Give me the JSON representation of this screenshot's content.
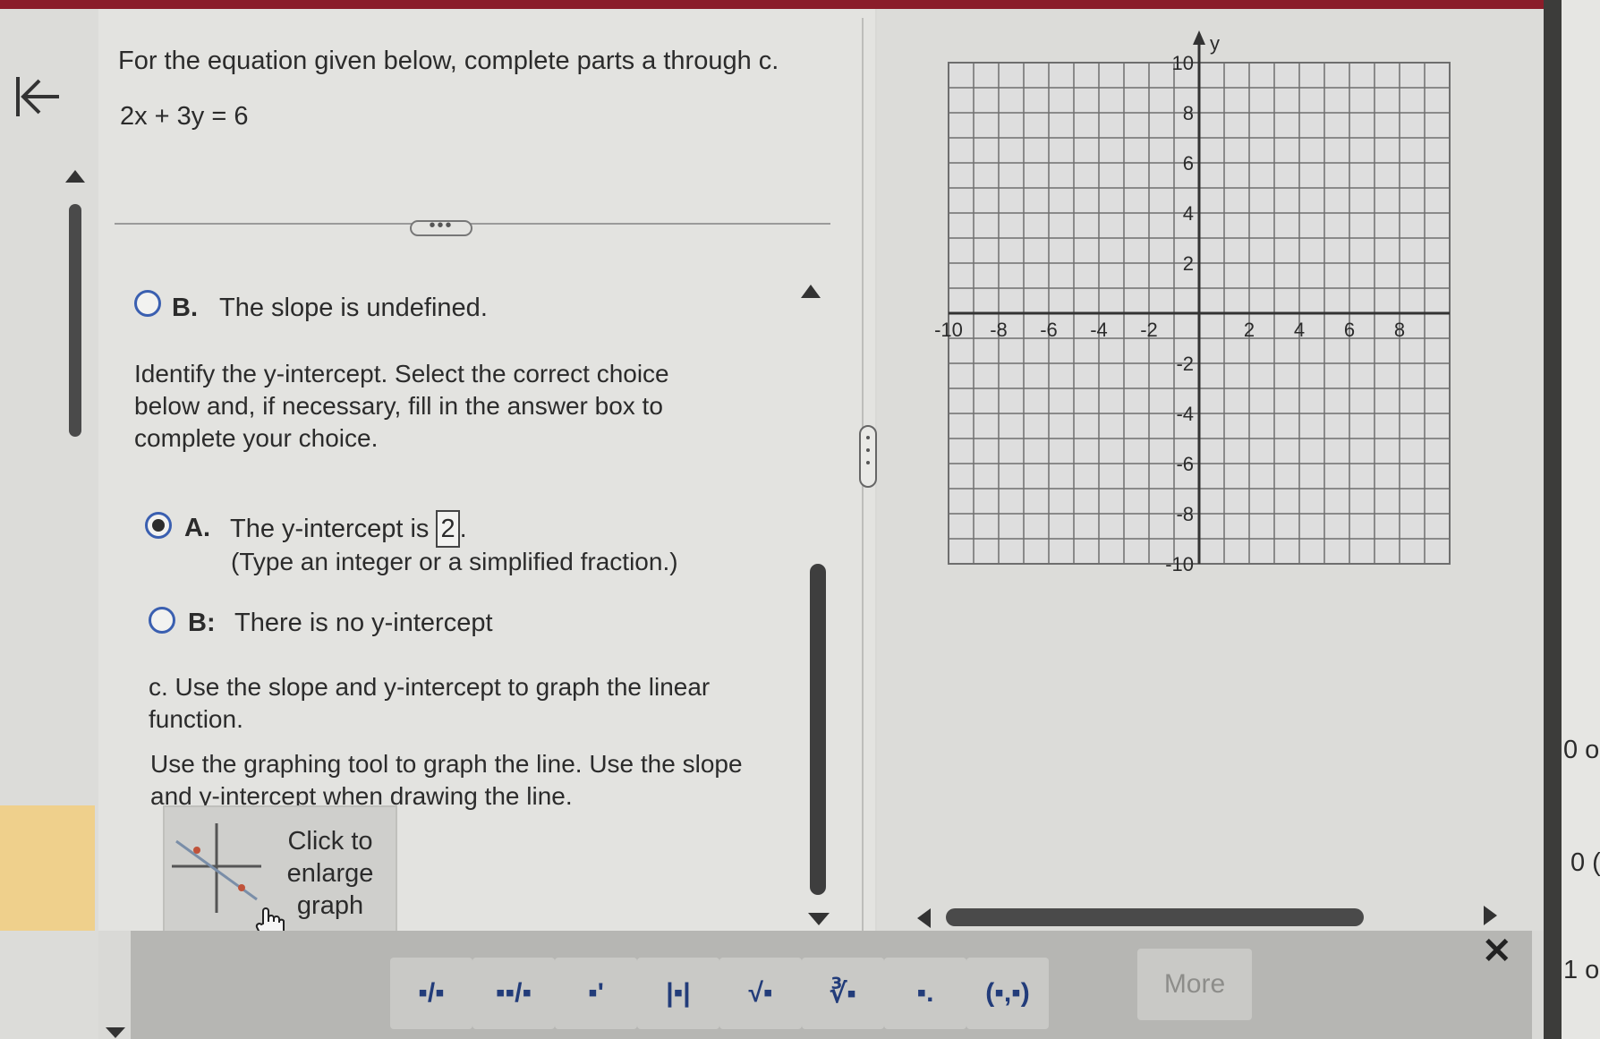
{
  "problem": {
    "intro": "For the equation given below, complete parts a through c.",
    "equation": "2x + 3y = 6",
    "expand_label": "•••"
  },
  "slope_choice_b": {
    "letter": "B.",
    "text": "The slope is undefined."
  },
  "y_intercept": {
    "prompt_lines": [
      "Identify the y-intercept. Select the correct choice",
      "below and, if necessary, fill in the answer box to",
      "complete your choice."
    ],
    "option_a": {
      "letter": "A.",
      "text_before": "The y-intercept is",
      "answer_value": "2",
      "text_after": ".",
      "hint": "(Type an integer or a simplified fraction.)",
      "selected": true
    },
    "option_b": {
      "letter": "B:",
      "text": "There is no y-intercept",
      "selected": false
    }
  },
  "part_c": {
    "line1": "c. Use the slope and y-intercept to graph the linear",
    "line2": "function.",
    "instruction1": "Use the graphing tool to graph the line. Use the slope",
    "instruction2": "and y-intercept when drawing the line.",
    "enlarge_lines": [
      "Click to",
      "enlarge",
      "graph"
    ]
  },
  "graph": {
    "y_axis_label": "y",
    "x_range": [
      -10,
      10
    ],
    "y_range": [
      -10,
      10
    ],
    "x_tick_labels": [
      "-10",
      "-8",
      "-6",
      "-4",
      "-2",
      "2",
      "4",
      "6",
      "8"
    ],
    "y_tick_labels": [
      "10",
      "8",
      "6",
      "4",
      "2",
      "-2",
      "-4",
      "-6",
      "-8",
      "-10"
    ],
    "grid": true,
    "grid_color": "#6f6f6f"
  },
  "side_fragments": [
    "0 o",
    "0 (",
    "1 o"
  ],
  "toolbar": {
    "buttons": [
      {
        "icon": "fraction-icon",
        "glyph": "▪/▪"
      },
      {
        "icon": "mixed-number-icon",
        "glyph": "▪▪/▪"
      },
      {
        "icon": "exponent-icon",
        "glyph": "▪'"
      },
      {
        "icon": "absolute-value-icon",
        "glyph": "|▪|"
      },
      {
        "icon": "square-root-icon",
        "glyph": "√▪"
      },
      {
        "icon": "nth-root-icon",
        "glyph": "∛▪"
      },
      {
        "icon": "subscript-icon",
        "glyph": "▪."
      },
      {
        "icon": "ordered-pair-icon",
        "glyph": "(▪,▪)"
      }
    ],
    "more_label": "More",
    "close_glyph": "✕"
  },
  "colors": {
    "radio_ring": "#3a5fb0",
    "top_bar": "#8a1d2a",
    "toolbar_icon": "#223c7a"
  }
}
